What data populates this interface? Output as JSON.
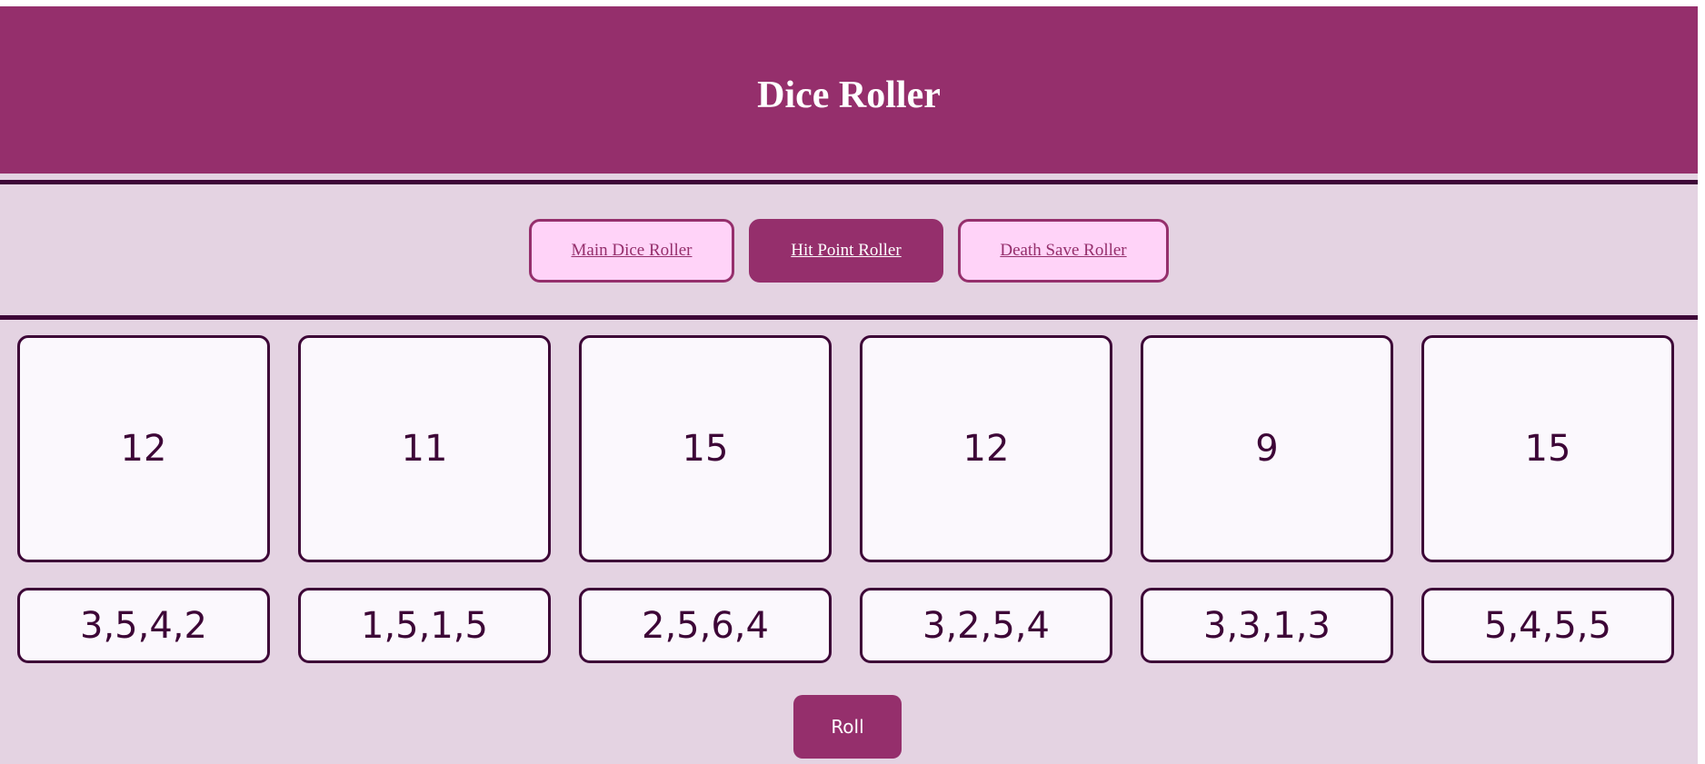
{
  "header": {
    "title": "Dice Roller"
  },
  "nav": {
    "items": [
      {
        "label": "Main Dice Roller",
        "active": false
      },
      {
        "label": "Hit Point Roller",
        "active": true
      },
      {
        "label": "Death Save Roller",
        "active": false
      }
    ]
  },
  "results": [
    {
      "total": "12",
      "rolls": "3,5,4,2"
    },
    {
      "total": "11",
      "rolls": "1,5,1,5"
    },
    {
      "total": "15",
      "rolls": "2,5,6,4"
    },
    {
      "total": "12",
      "rolls": "3,2,5,4"
    },
    {
      "total": "9",
      "rolls": "3,3,1,3"
    },
    {
      "total": "15",
      "rolls": "5,4,5,5"
    }
  ],
  "actions": {
    "roll_label": "Roll"
  },
  "colors": {
    "primary": "#952f6c",
    "background": "#e4d3e2",
    "dark": "#3d0637",
    "nav_inactive": "#ffd3f8",
    "card": "#fbf8fd"
  }
}
